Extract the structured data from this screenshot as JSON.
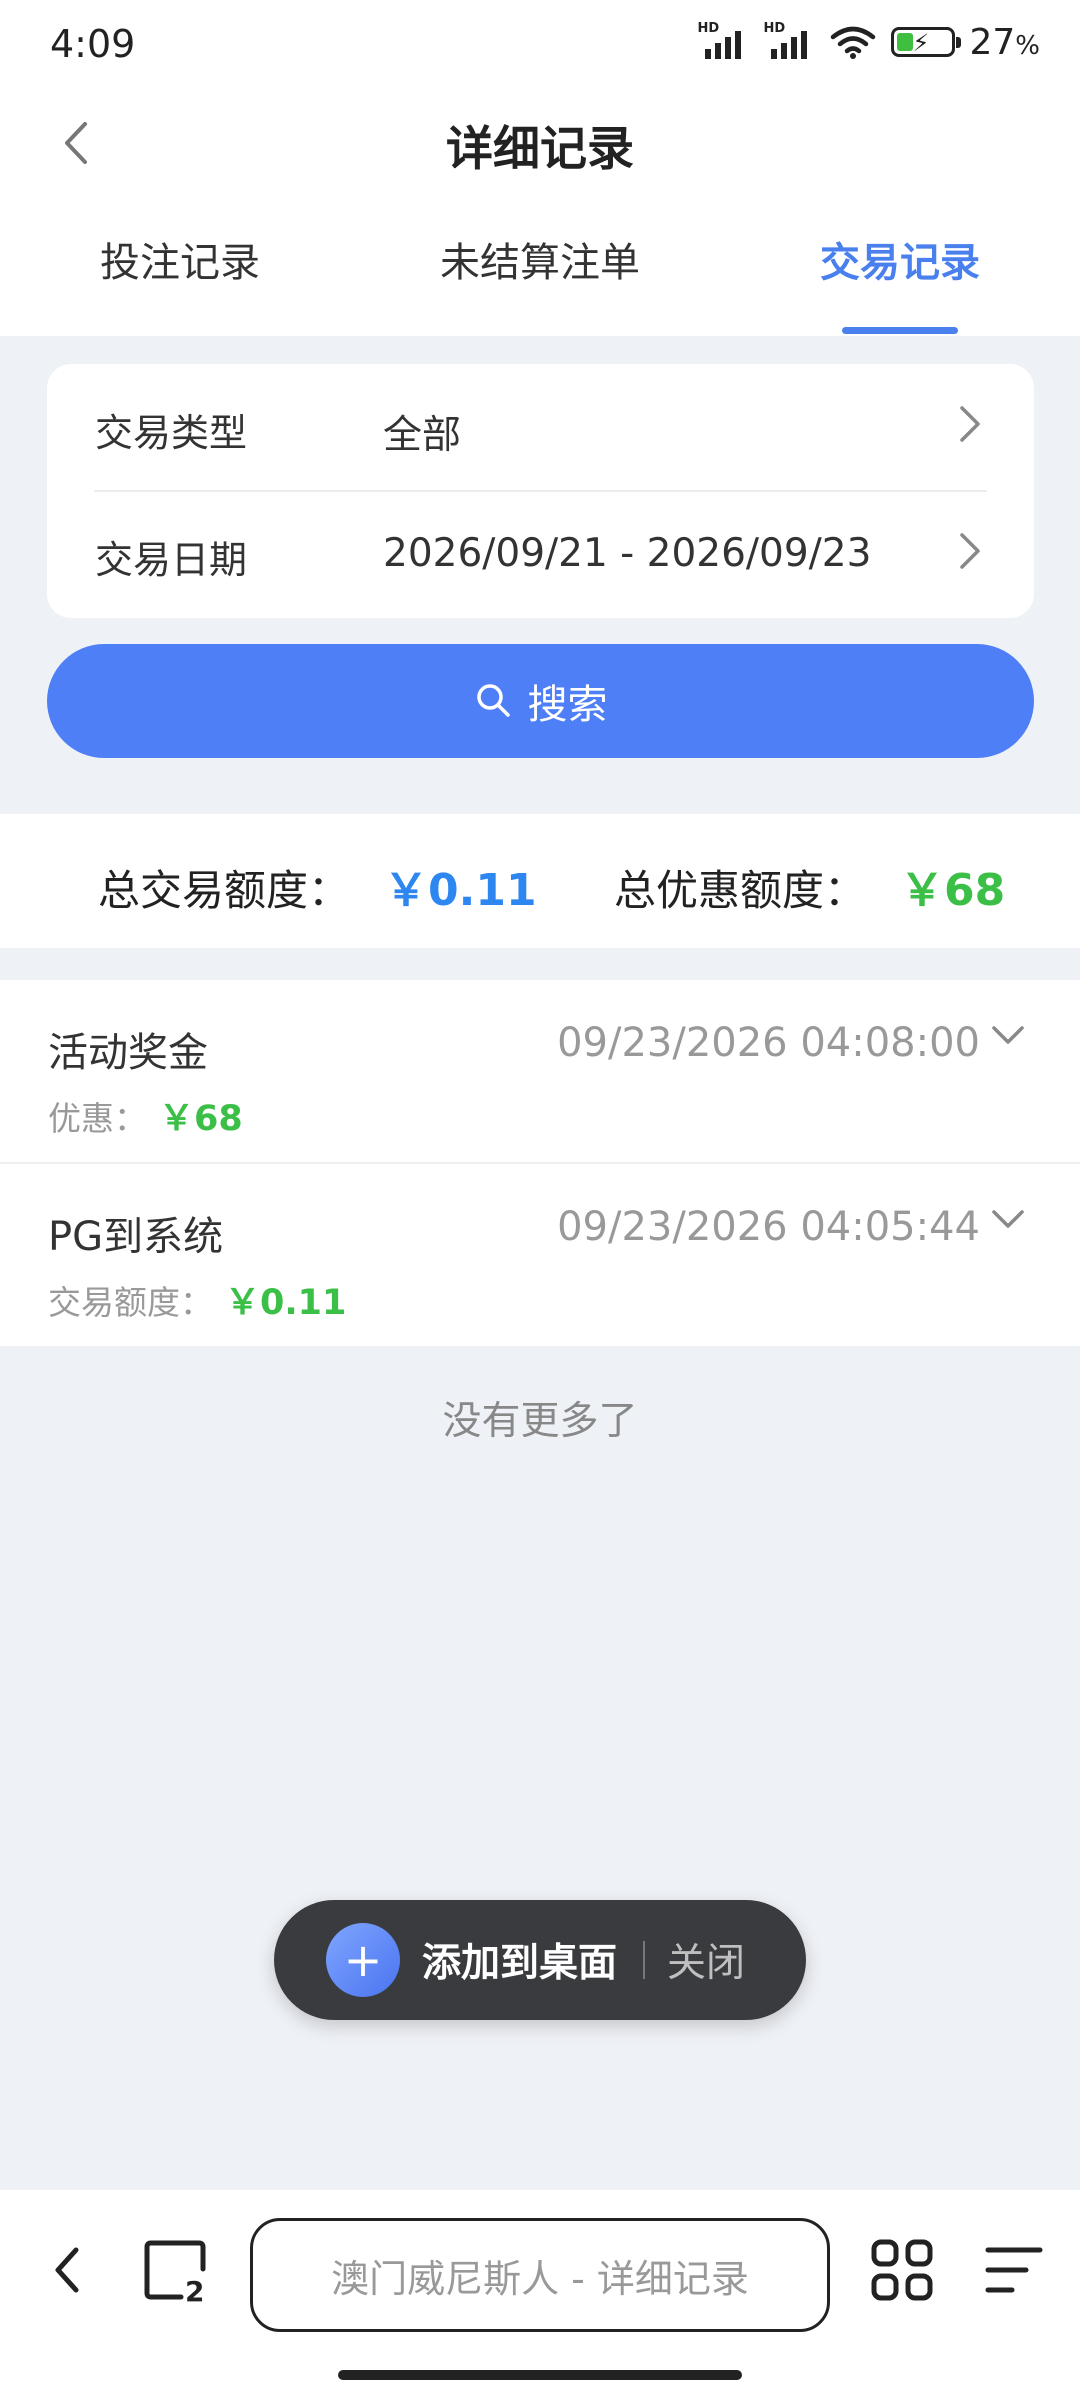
{
  "status_bar": {
    "time": "4:09",
    "battery_pct": "27",
    "battery_unit": "%",
    "signal_label": "HD"
  },
  "header": {
    "title": "详细记录",
    "back_icon": "chevron-left-icon"
  },
  "tabs": [
    {
      "label": "投注记录",
      "active": false
    },
    {
      "label": "未结算注单",
      "active": false
    },
    {
      "label": "交易记录",
      "active": true
    }
  ],
  "filters": {
    "type": {
      "label": "交易类型",
      "value": "全部"
    },
    "date": {
      "label": "交易日期",
      "value": "2026/09/21 - 2026/09/23"
    }
  },
  "search": {
    "label": "搜索",
    "icon": "search-icon"
  },
  "totals": {
    "transaction": {
      "label": "总交易额度：",
      "amount": "￥0.11"
    },
    "discount": {
      "label": "总优惠额度：",
      "amount": "￥68"
    }
  },
  "records": [
    {
      "name": "活动奖金",
      "time": "09/23/2026 04:08:00",
      "sub_label": "优惠：",
      "sub_value": "￥68"
    },
    {
      "name": "PG到系统",
      "time": "09/23/2026 04:05:44",
      "sub_label": "交易额度：",
      "sub_value": "￥0.11"
    }
  ],
  "no_more": "没有更多了",
  "toast": {
    "add_label": "添加到桌面",
    "close_label": "关闭"
  },
  "browser": {
    "url_text": "澳门威尼斯人 - 详细记录",
    "tab_count": "2"
  },
  "colors": {
    "accent": "#4a80ee",
    "search_button": "#4f7ff6",
    "amount_blue": "#2e86f0",
    "amount_green": "#3bbf47",
    "background": "#eef1f6"
  }
}
